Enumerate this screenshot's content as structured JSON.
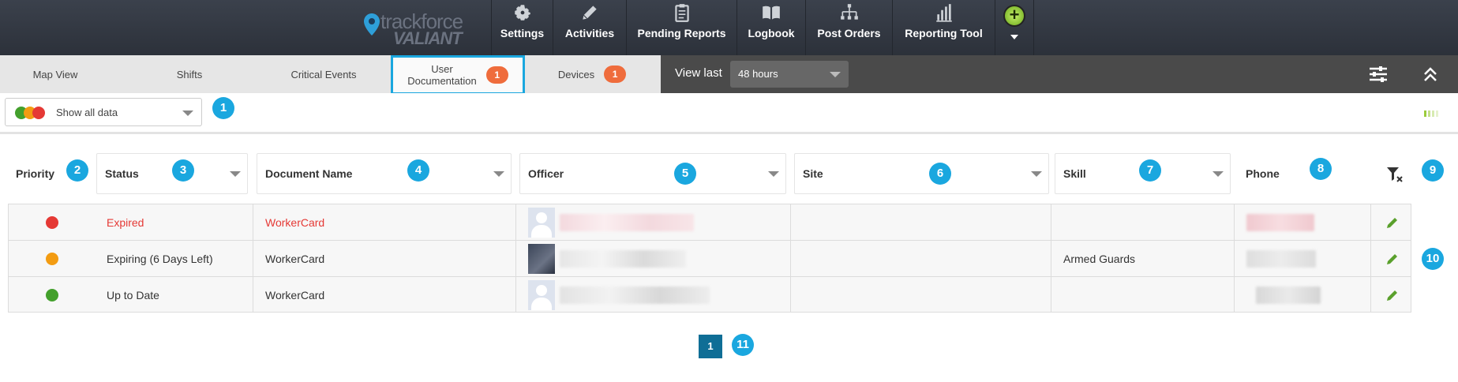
{
  "nav": {
    "logo_top": "trackforce",
    "logo_bottom": "VALIANT",
    "items": [
      {
        "label": "Settings",
        "icon": "gear-icon"
      },
      {
        "label": "Activities",
        "icon": "pencil-icon"
      },
      {
        "label": "Pending Reports",
        "icon": "clipboard-icon"
      },
      {
        "label": "Logbook",
        "icon": "book-icon"
      },
      {
        "label": "Post Orders",
        "icon": "org-chart-icon"
      },
      {
        "label": "Reporting Tool",
        "icon": "bar-chart-icon"
      }
    ],
    "plus_label": "+"
  },
  "tabs": [
    {
      "label": "Map View"
    },
    {
      "label": "Shifts"
    },
    {
      "label": "Critical Events"
    },
    {
      "label_line1": "User",
      "label_line2": "Documentation",
      "badge": "1",
      "active": true
    },
    {
      "label": "Devices",
      "badge": "1"
    }
  ],
  "view": {
    "label": "View last",
    "selected": "48 hours"
  },
  "filter": {
    "label": "Show all data"
  },
  "table": {
    "headers": {
      "priority": "Priority",
      "status": "Status",
      "document": "Document Name",
      "officer": "Officer",
      "site": "Site",
      "skill": "Skill",
      "phone": "Phone"
    },
    "rows": [
      {
        "priority_color": "#e53935",
        "status": "Expired",
        "document": "WorkerCard",
        "skill": "",
        "expired": true
      },
      {
        "priority_color": "#f39c12",
        "status": "Expiring (6 Days Left)",
        "document": "WorkerCard",
        "skill": "Armed Guards",
        "expired": false
      },
      {
        "priority_color": "#43a02c",
        "status": "Up to Date",
        "document": "WorkerCard",
        "skill": "",
        "expired": false
      }
    ]
  },
  "pagination": {
    "current": "1"
  },
  "callouts": [
    "1",
    "2",
    "3",
    "4",
    "5",
    "6",
    "7",
    "8",
    "9",
    "10",
    "11"
  ],
  "colors": {
    "accent": "#1aa7df",
    "badge": "#ef6c3c",
    "expired_text": "#e53935",
    "edit_green": "#5aa02c"
  }
}
